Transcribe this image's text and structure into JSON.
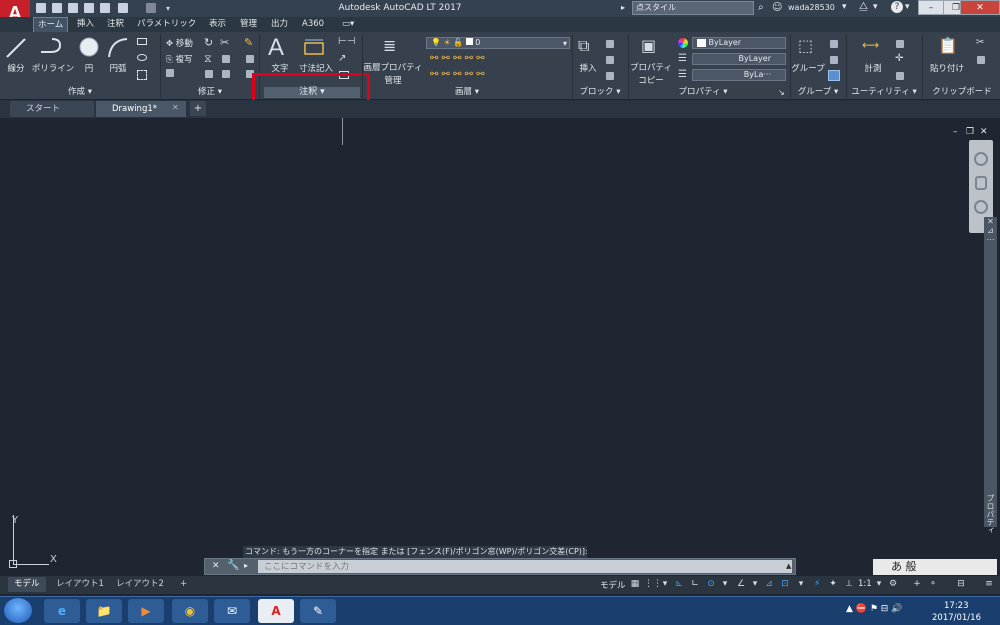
{
  "titlebar": {
    "window_title": "Autodesk AutoCAD LT 2017",
    "search_value": "点スタイル",
    "user_name": "wada28530",
    "app_logo_text": "A",
    "app_logo_sub": "LT",
    "minimize": "–",
    "maximize": "❐",
    "close": "✕"
  },
  "ribbon_tabs": [
    "ホーム",
    "挿入",
    "注釈",
    "パラメトリック",
    "表示",
    "管理",
    "出力",
    "A360",
    "▭▾"
  ],
  "panels": {
    "draw": {
      "title": "作成 ▾",
      "line": "線分",
      "polyline": "ポリライン",
      "circle": "円",
      "arc": "円弧"
    },
    "modify": {
      "title": "修正 ▾",
      "move": "移動",
      "copy": "複写"
    },
    "annotation": {
      "title": "注釈 ▾",
      "text": "文字",
      "dimension": "寸法記入"
    },
    "layers": {
      "title": "画層 ▾",
      "layer_properties": "画層プロパティ",
      "layer_manage": "管理",
      "layer_value": "0"
    },
    "block": {
      "title": "ブロック ▾",
      "insert": "挿入"
    },
    "properties": {
      "title": "プロパティ ▾",
      "match_properties": "プロパティ",
      "match_properties_2": "コピー",
      "color": "ByLayer",
      "linetype": "ByLayer",
      "lineweight": "ByLa···",
      "launcher": "↘"
    },
    "groups": {
      "title": "グループ ▾",
      "group": "グループ"
    },
    "utilities": {
      "title": "ユーティリティ ▾",
      "measure": "計測"
    },
    "clipboard": {
      "title": "クリップボード",
      "paste": "貼り付け"
    }
  },
  "file_tabs": [
    "スタート",
    "Drawing1*"
  ],
  "file_tab_add": "+",
  "file_tab_close": "✕",
  "viewport_controls": {
    "minimize": "–",
    "restore": "❐",
    "close": "✕"
  },
  "ucs": {
    "x": "X",
    "y": "Y"
  },
  "command": {
    "history": "コマンド: もう一方のコーナーを指定 または [フェンス(F)/ポリゴン窓(WP)/ポリゴン交差(CP)]:",
    "placeholder": "ここにコマンドを入力"
  },
  "layout_tabs": [
    "モデル",
    "レイアウト1",
    "レイアウト2"
  ],
  "layout_add": "+",
  "status": {
    "model_label": "モデル",
    "scale": "1:1",
    "tools": [
      "▦",
      "⋮⋮",
      "▾",
      "⊾",
      "∟",
      "⊙",
      "▾",
      "∠",
      "▾",
      "⊿",
      "⊡",
      "▾",
      "⚡",
      "✦",
      "⟂",
      "▾",
      "⚙",
      "+",
      "⚬",
      "⊟",
      "≡"
    ]
  },
  "side_palette": {
    "close": "✕",
    "pin": "⊿",
    "settings": "⋯",
    "label": "プロパティ"
  },
  "ime": {
    "mode": "あ 般",
    "tools": "🔴"
  },
  "taskbar": {
    "apps": [
      "e",
      "📁",
      "▶",
      "◉",
      "✉",
      "A",
      "✎"
    ],
    "time": "17:23",
    "date": "2017/01/16",
    "tray": "▲ ⛔ ⚑ ⊟ 🔊"
  }
}
